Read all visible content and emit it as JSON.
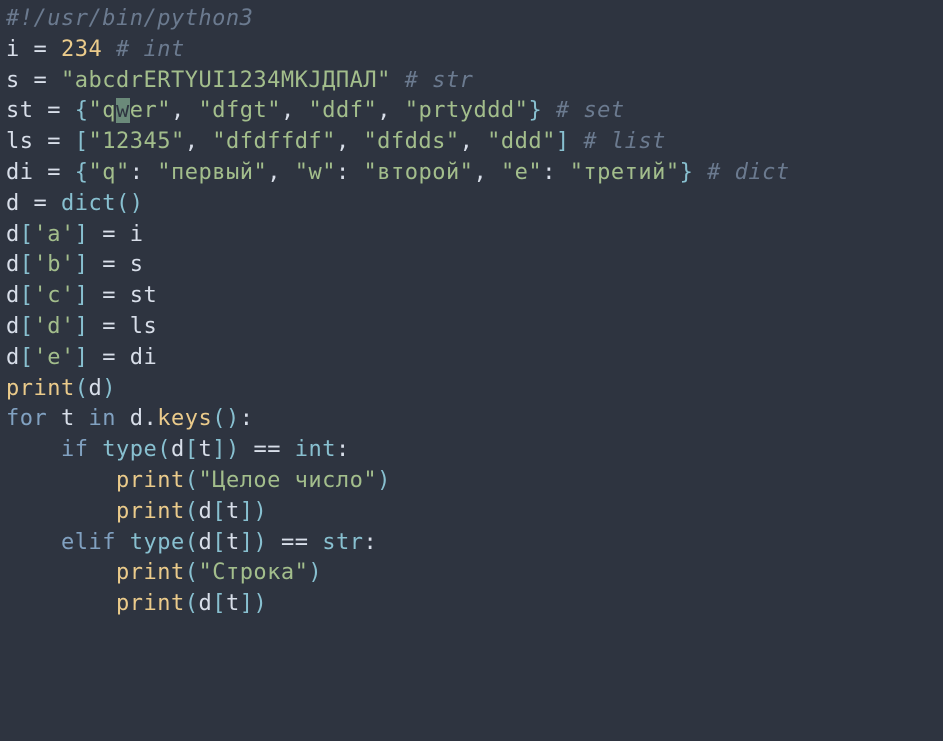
{
  "colors": {
    "bg": "#2e3440",
    "fg": "#d8dee9",
    "comment": "#6b7a8f",
    "string": "#a3be8c",
    "number": "#ebcb8b",
    "keyword": "#81a1c1",
    "builtin": "#88c0d0",
    "cursor_bg": "#6b8a7a"
  },
  "cursor": {
    "line": 4,
    "col": 10,
    "char": "w"
  },
  "lines": {
    "l1_shebang": "#!/usr/bin/python3",
    "l2": {
      "var": "i",
      "op": " = ",
      "val": "234",
      "comment": " # int"
    },
    "l3": {
      "var": "s",
      "op": " = ",
      "val": "\"abcdrERTYUI1234MKJДПАЛ\"",
      "comment": " # str"
    },
    "l4": {
      "var": "st",
      "op": " = ",
      "open": "{",
      "items": [
        "\"q",
        "w",
        "er\"",
        "\"dfgt\"",
        "\"ddf\"",
        "\"prtyddd\""
      ],
      "sep": ", ",
      "close": "}",
      "comment": " # set"
    },
    "l5": {
      "var": "ls",
      "op": " = ",
      "open": "[",
      "items": [
        "\"12345\"",
        "\"dfdffdf\"",
        "\"dfdds\"",
        "\"ddd\""
      ],
      "sep": ", ",
      "close": "]",
      "comment": " # list"
    },
    "l6": {
      "var": "di",
      "op": " = ",
      "open": "{",
      "pairs": [
        {
          "k": "\"q\"",
          "c": ": ",
          "v": "\"первый\""
        },
        {
          "k": "\"w\"",
          "c": ": ",
          "v": "\"второй\""
        },
        {
          "k": "\"e\"",
          "c": ": ",
          "v": "\"третий\""
        }
      ],
      "sep": ", ",
      "close": "}",
      "comment": " # dict"
    },
    "l7": {
      "var": "d",
      "op": " = ",
      "fn": "dict",
      "paren": "()"
    },
    "l8": {
      "var": "d",
      "ob": "[",
      "key": "'a'",
      "cb": "]",
      "op": " = ",
      "rhs": "i"
    },
    "l9": {
      "var": "d",
      "ob": "[",
      "key": "'b'",
      "cb": "]",
      "op": " = ",
      "rhs": "s"
    },
    "l10": {
      "var": "d",
      "ob": "[",
      "key": "'c'",
      "cb": "]",
      "op": " = ",
      "rhs": "st"
    },
    "l11": {
      "var": "d",
      "ob": "[",
      "key": "'d'",
      "cb": "]",
      "op": " = ",
      "rhs": "ls"
    },
    "l12": {
      "var": "d",
      "ob": "[",
      "key": "'e'",
      "cb": "]",
      "op": " = ",
      "rhs": "di"
    },
    "blank": "",
    "l14": {
      "fn": "print",
      "open": "(",
      "arg": "d",
      "close": ")"
    },
    "l16": {
      "kw_for": "for",
      "sp1": " ",
      "var": "t",
      "sp2": " ",
      "kw_in": "in",
      "sp3": " ",
      "obj": "d",
      "dot": ".",
      "method": "keys",
      "paren": "()",
      "colon": ":"
    },
    "l17": {
      "indent": "    ",
      "kw_if": "if",
      "sp1": " ",
      "fn": "type",
      "open": "(",
      "obj": "d",
      "ob": "[",
      "idx": "t",
      "cb": "]",
      "close": ")",
      "sp2": " ",
      "op": "==",
      "sp3": " ",
      "ty": "int",
      "colon": ":"
    },
    "l18": {
      "indent": "        ",
      "fn": "print",
      "open": "(",
      "arg": "\"Целое число\"",
      "close": ")"
    },
    "l19": {
      "indent": "        ",
      "fn": "print",
      "open": "(",
      "obj": "d",
      "ob": "[",
      "idx": "t",
      "cb": "]",
      "close": ")"
    },
    "l20": {
      "indent": "    ",
      "kw_elif": "elif",
      "sp1": " ",
      "fn": "type",
      "open": "(",
      "obj": "d",
      "ob": "[",
      "idx": "t",
      "cb": "]",
      "close": ")",
      "sp2": " ",
      "op": "==",
      "sp3": " ",
      "ty": "str",
      "colon": ":"
    },
    "l21": {
      "indent": "        ",
      "fn": "print",
      "open": "(",
      "arg": "\"Строка\"",
      "close": ")"
    },
    "l22": {
      "indent": "        ",
      "fn": "print",
      "open": "(",
      "obj": "d",
      "ob": "[",
      "idx": "t",
      "cb": "]",
      "close": ")"
    }
  }
}
